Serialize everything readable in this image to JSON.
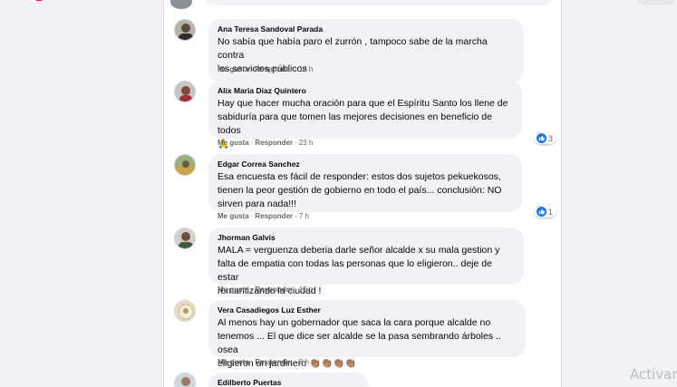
{
  "comments": [
    {
      "author": "Ana Teresa Sandoval Parada",
      "text": "No sabía que había paro el zurrón , tampoco sabe de la marcha contra\nlos servicios públicos",
      "like_label": "Me gusta",
      "reply_label": "Responder",
      "time": "16 h",
      "reactions": ""
    },
    {
      "author": "Alix Maria Diaz Quintero",
      "text": "Hay que hacer mucha oración para que el Espíritu Santo los llene de\nsabiduría para que tomen las mejores decisiones en beneficio de todos\n🙏",
      "like_label": "Me gusta",
      "reply_label": "Responder",
      "time": "23 h",
      "reactions": "3"
    },
    {
      "author": "Edgar Correa Sanchez",
      "text": "Esa encuesta es fácil de responder: estos dos sujetos pekuekosos,\ntienen la peor gestión de gobierno en todo el país... conclusión: NO\nsirven para nada!!!",
      "like_label": "Me gusta",
      "reply_label": "Responder",
      "time": "7 h",
      "reactions": "1"
    },
    {
      "author": "Jhorman Galvis",
      "text": "MALA = verguenza deberia darle señor alcalde x su mala gestion y\nfalta de empatia con todas las personas que lo eligieron.. deje de estar\nromantizando la ciudad !",
      "like_label": "Me gusta",
      "reply_label": "Responder",
      "time": "16 h",
      "reactions": ""
    },
    {
      "author": "Vera Casadiegos Luz Esther",
      "text": "Al menos hay un gobernador que saca la cara porque alcalde no\ntenemos ... El que dice ser alcalde se la pasa sembrando árboles .. osea\neligieron un jardinero 👏🏽👏🏽👏🏽👏🏽",
      "like_label": "Me gusta",
      "reply_label": "Responder",
      "time": "9 h",
      "reactions": ""
    },
    {
      "author": "Edilberto Puertas",
      "text": "",
      "like_label": "",
      "reply_label": "",
      "time": "",
      "reactions": ""
    }
  ],
  "separator": "·",
  "watermark": "Activar",
  "colors": {
    "accent": "#1877f2",
    "bubble": "#f0f2f5",
    "meta": "#65676b"
  }
}
